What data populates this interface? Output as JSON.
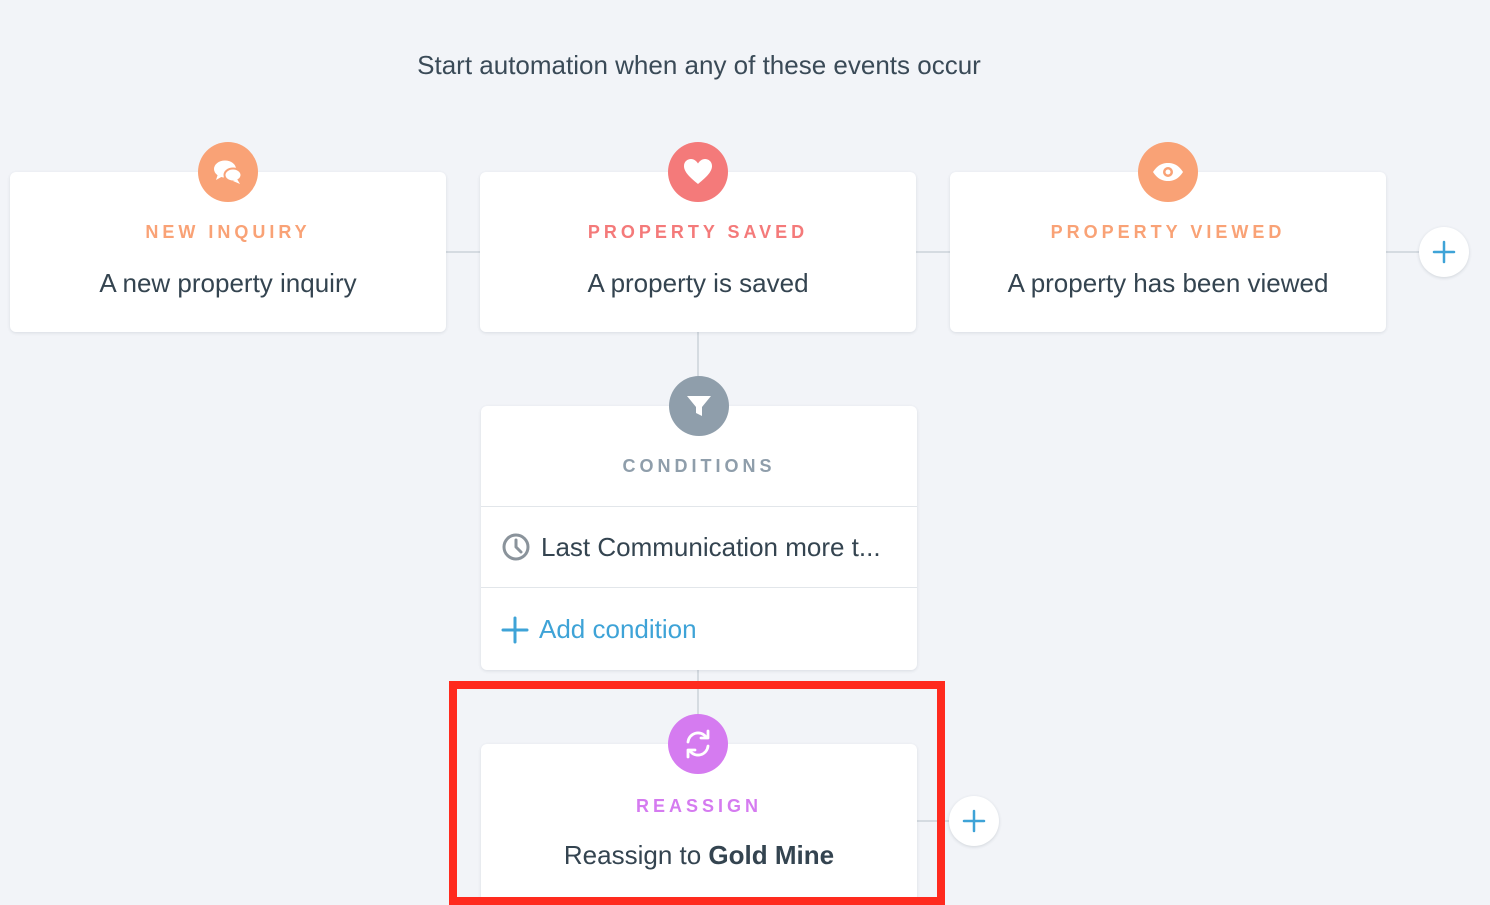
{
  "heading": "Start automation when any of these events occur",
  "triggers": [
    {
      "title": "NEW INQUIRY",
      "description": "A new property inquiry",
      "color": "#f9a276",
      "icon": "chat-bubbles-icon"
    },
    {
      "title": "PROPERTY SAVED",
      "description": "A property is saved",
      "color": "#f47a7a",
      "icon": "heart-icon"
    },
    {
      "title": "PROPERTY VIEWED",
      "description": "A property has been viewed",
      "color": "#f9a276",
      "icon": "eye-icon"
    }
  ],
  "conditions": {
    "title": "CONDITIONS",
    "color": "#8f9eab",
    "icon": "filter-icon",
    "items": [
      {
        "text": "Last Communication more t...",
        "icon": "clock-icon"
      }
    ],
    "add_label": "Add condition",
    "add_icon": "plus-icon"
  },
  "action": {
    "title": "REASSIGN",
    "color": "#d57bf0",
    "icon": "refresh-icon",
    "text_prefix": "Reassign to ",
    "text_bold": "Gold Mine"
  },
  "accent_color": "#3ea3d7",
  "highlight_color": "#ff2a1e"
}
